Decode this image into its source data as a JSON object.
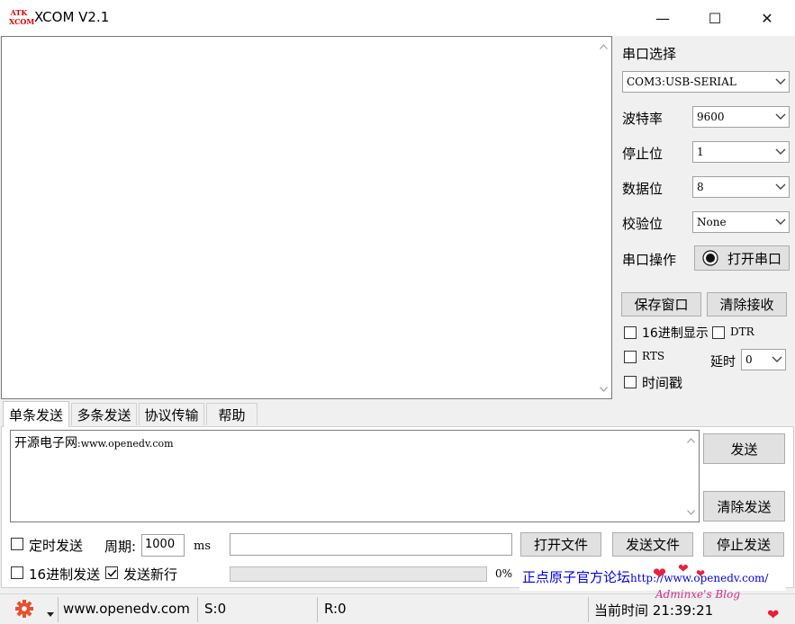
{
  "window": {
    "title": "XCOM V2.1",
    "logo_text_top": "ATK",
    "logo_text_bottom": "XCOM",
    "controls": {
      "minimize": "—",
      "maximize": "☐",
      "close": "✕"
    }
  },
  "serial": {
    "port_label": "串口选择",
    "port_value": "COM3:USB-SERIAL",
    "baud_label": "波特率",
    "baud_value": "9600",
    "stop_label": "停止位",
    "stop_value": "1",
    "data_label": "数据位",
    "data_value": "8",
    "parity_label": "校验位",
    "parity_value": "None",
    "op_label": "串口操作",
    "open_button": "打开串口",
    "save_window": "保存窗口",
    "clear_receive": "清除接收",
    "hex_display": "16进制显示",
    "dtr": "DTR",
    "rts": "RTS",
    "delay_label": "延时",
    "delay_value": "0",
    "timestamp": "时间戳"
  },
  "tabs": [
    "单条发送",
    "多条发送",
    "协议传输",
    "帮助"
  ],
  "send": {
    "text_cn": "开源电子网",
    "text_url": ":www.openedv.com",
    "send_button": "发送",
    "clear_send": "清除发送",
    "timed_send": "定时发送",
    "period_label": "周期:",
    "period_value": "1000",
    "period_unit": "ms",
    "open_file": "打开文件",
    "send_file": "发送文件",
    "stop_send": "停止发送",
    "hex_send": "16进制发送",
    "newline_send": "发送新行",
    "newline_checked": true,
    "progress_text": "0%",
    "progress": 0
  },
  "ad": {
    "text": "正点原子官方论坛",
    "url": "http://www.openedv.com/"
  },
  "status": {
    "site": "www.openedv.com",
    "sent": "S:0",
    "received": "R:0",
    "time_label": "当前时间",
    "time_value": "21:39:21"
  },
  "watermark": "Adminxe's Blog",
  "icons": {
    "settings": "gear-icon",
    "dropdown": "chevron-down-icon"
  },
  "colors": {
    "gear": "#e8502a",
    "ad_link": "#0000ee",
    "logo": "#dd0000"
  }
}
